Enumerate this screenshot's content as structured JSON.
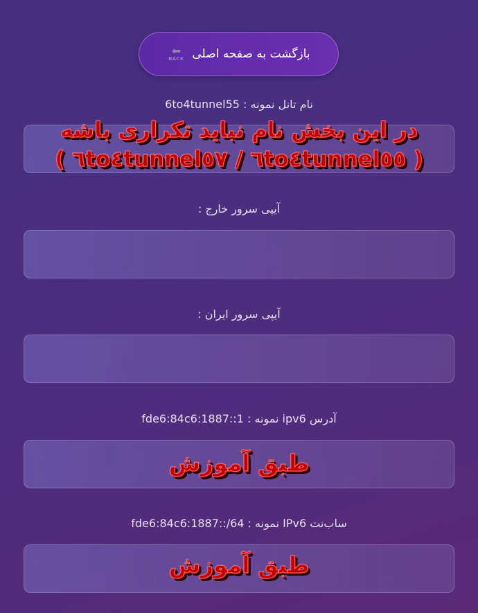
{
  "back_button": {
    "label": "بازگشت به صفحه اصلی",
    "icon": "back-arrow-icon",
    "icon_arrow": "⬅",
    "icon_text": "BACK"
  },
  "fields": [
    {
      "label": "نام تانل نمونه : 6to4tunnel55",
      "value": ""
    },
    {
      "label": "آیپی سرور خارج :",
      "value": ""
    },
    {
      "label": "آیپی سرور ایران :",
      "value": ""
    },
    {
      "label": "آدرس ipv6 نمونه : fde6:84c6:1887::1",
      "value": ""
    },
    {
      "label": "ساب‌نت IPv6 نمونه : fde6:84c6:1887::/64",
      "value": ""
    }
  ],
  "overlays": {
    "name_note_line1": "در این بخش نام نباید تکراری باشه",
    "name_note_line2": "( ٦to٤tunnel٥٥ / ٦to٤tunnel٥٧ )",
    "ipv6_note": "طبق آموزش",
    "subnet_note": "طبق آموزش"
  },
  "colors": {
    "background_start": "#46307e",
    "background_end": "#5a2a76",
    "button": "#6b2fb0",
    "overlay_text": "#c40000"
  }
}
